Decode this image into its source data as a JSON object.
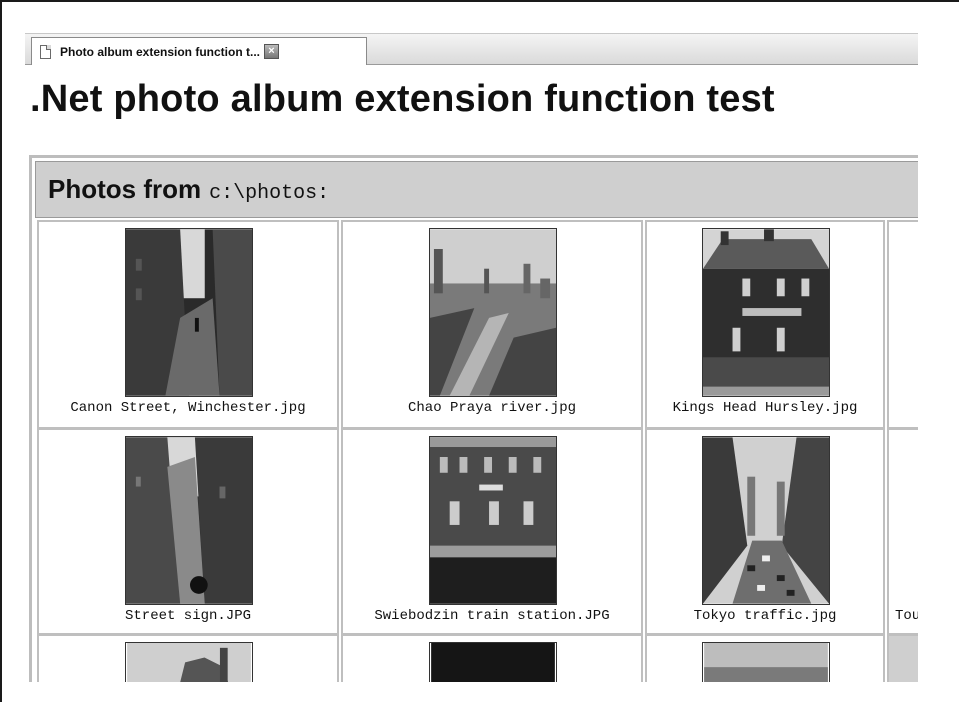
{
  "tab": {
    "title": "Photo album extension function t...",
    "close_glyph": "×",
    "icon": "document-icon"
  },
  "page": {
    "title": ".Net photo album extension function test"
  },
  "album": {
    "header_label": "Photos from",
    "header_path": "c:\\photos:",
    "rows": [
      [
        {
          "caption": "Canon Street, Winchester.jpg",
          "photo": "narrow-street-photo"
        },
        {
          "caption": "Chao Praya river.jpg",
          "photo": "river-city-photo"
        },
        {
          "caption": "Kings Head Hursley.jpg",
          "photo": "pub-building-photo"
        },
        {
          "caption": "",
          "photo": ""
        }
      ],
      [
        {
          "caption": "Street sign.JPG",
          "photo": "alley-photo"
        },
        {
          "caption": "Swiebodzin train station.JPG",
          "photo": "train-station-photo"
        },
        {
          "caption": "Tokyo traffic.jpg",
          "photo": "traffic-street-photo"
        },
        {
          "caption": "Tou",
          "photo": ""
        }
      ]
    ]
  }
}
